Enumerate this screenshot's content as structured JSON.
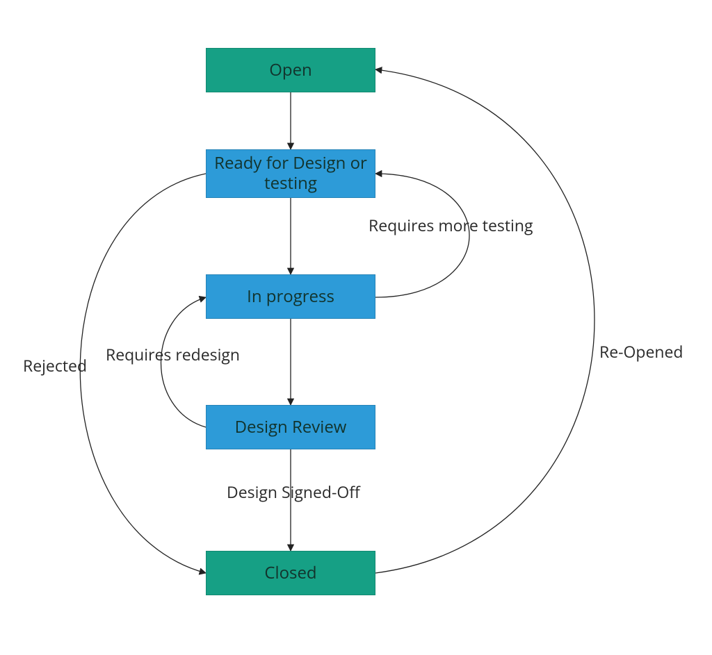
{
  "diagram": {
    "type": "state_flow",
    "colors": {
      "status_bg": "#16a085",
      "activity_bg": "#2d9bd8",
      "edge": "#222222",
      "text": "#12332c"
    },
    "nodes": {
      "open": {
        "label": "Open",
        "kind": "status"
      },
      "ready": {
        "label": "Ready for Design or testing",
        "kind": "activity"
      },
      "in_progress": {
        "label": "In progress",
        "kind": "activity"
      },
      "design_review": {
        "label": "Design Review",
        "kind": "activity"
      },
      "closed": {
        "label": "Closed",
        "kind": "status"
      }
    },
    "edges": [
      {
        "from": "open",
        "to": "ready",
        "label": ""
      },
      {
        "from": "ready",
        "to": "in_progress",
        "label": ""
      },
      {
        "from": "in_progress",
        "to": "design_review",
        "label": ""
      },
      {
        "from": "design_review",
        "to": "closed",
        "label": "Design Signed-Off"
      },
      {
        "from": "in_progress",
        "to": "ready",
        "label": "Requires more testing"
      },
      {
        "from": "design_review",
        "to": "in_progress",
        "label": "Requires redesign"
      },
      {
        "from": "ready",
        "to": "closed",
        "label": "Rejected"
      },
      {
        "from": "closed",
        "to": "open",
        "label": "Re-Opened"
      }
    ]
  }
}
